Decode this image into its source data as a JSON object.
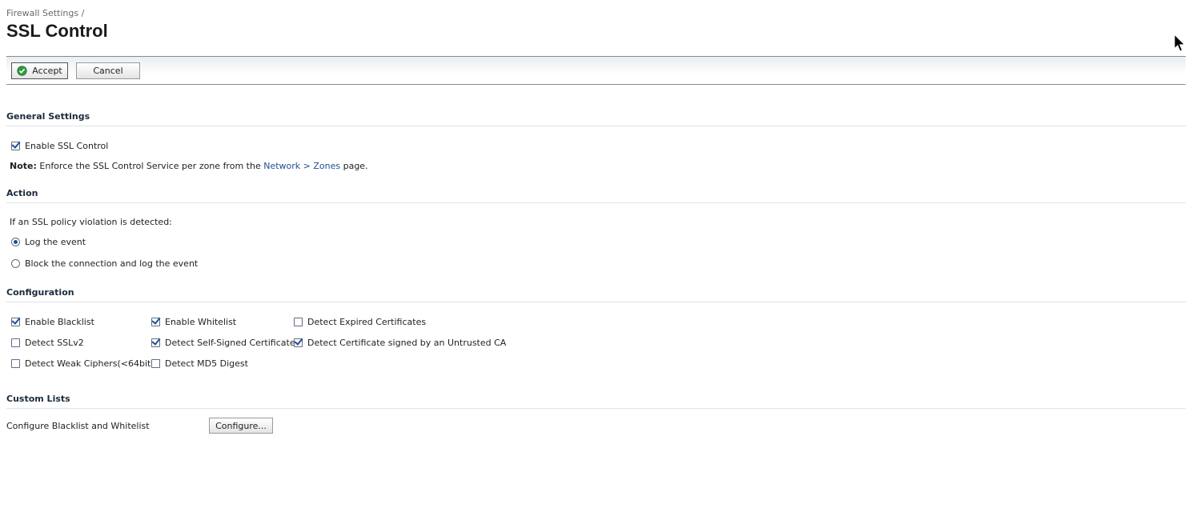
{
  "header": {
    "breadcrumb": "Firewall Settings /",
    "title": "SSL Control"
  },
  "toolbar": {
    "accept_label": "Accept",
    "cancel_label": "Cancel"
  },
  "general": {
    "title": "General Settings",
    "enable_ssl": {
      "label": "Enable SSL Control",
      "checked": true
    },
    "note_label": "Note:",
    "note_text": "Enforce the SSL Control Service per zone from the",
    "note_link": "Network > Zones",
    "note_suffix": "page."
  },
  "action": {
    "title": "Action",
    "prompt": "If an SSL policy violation is detected:",
    "options": [
      {
        "label": "Log the event",
        "selected": true
      },
      {
        "label": "Block the connection and log the event",
        "selected": false
      }
    ]
  },
  "configuration": {
    "title": "Configuration",
    "items": [
      {
        "label": "Enable Blacklist",
        "checked": true
      },
      {
        "label": "Enable Whitelist",
        "checked": true
      },
      {
        "label": "Detect Expired Certificates",
        "checked": false
      },
      {
        "label": "Detect SSLv2",
        "checked": false
      },
      {
        "label": "Detect Self-Signed Certificates",
        "checked": true
      },
      {
        "label": "Detect Certificate signed by an Untrusted CA",
        "checked": true
      },
      {
        "label": "Detect Weak Ciphers(<64bits)",
        "checked": false
      },
      {
        "label": "Detect MD5 Digest",
        "checked": false
      }
    ]
  },
  "custom_lists": {
    "title": "Custom Lists",
    "label": "Configure Blacklist and Whitelist",
    "button_label": "Configure..."
  },
  "colors": {
    "accent": "#1f4f8f",
    "accept_icon": "#2e9a3e"
  },
  "icons": {
    "accept": "check-circle-icon",
    "cursor": "mouse-cursor-icon"
  }
}
